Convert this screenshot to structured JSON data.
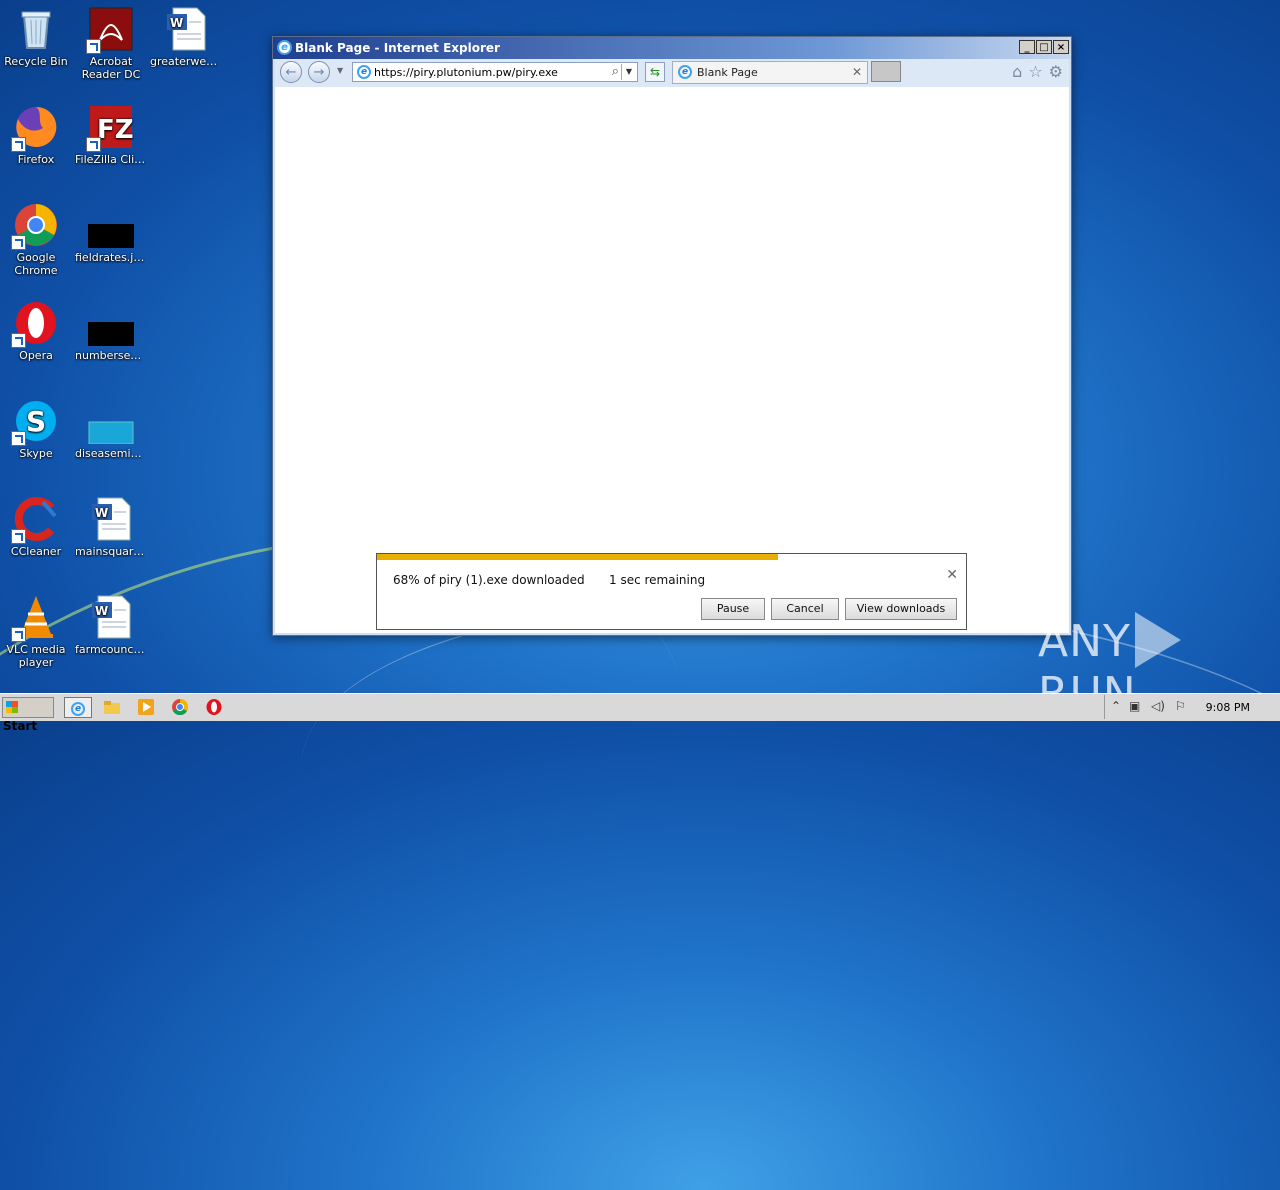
{
  "desktop": {
    "icons": [
      {
        "label": "Recycle Bin",
        "icon": "recycle-bin-icon"
      },
      {
        "label": "Acrobat Reader DC",
        "icon": "acrobat-icon"
      },
      {
        "label": "greaterwee...",
        "icon": "word-doc-icon"
      },
      {
        "label": "Firefox",
        "icon": "firefox-icon"
      },
      {
        "label": "FileZilla Client",
        "icon": "filezilla-icon"
      },
      {
        "label": "Google Chrome",
        "icon": "chrome-icon"
      },
      {
        "label": "fieldrates.jpg",
        "icon": "image-file-icon"
      },
      {
        "label": "Opera",
        "icon": "opera-icon"
      },
      {
        "label": "numbersex...",
        "icon": "image-file-icon"
      },
      {
        "label": "Skype",
        "icon": "skype-icon"
      },
      {
        "label": "diseasemini....",
        "icon": "image-file-icon"
      },
      {
        "label": "CCleaner",
        "icon": "ccleaner-icon"
      },
      {
        "label": "mainsquare.rtf",
        "icon": "word-doc-icon"
      },
      {
        "label": "VLC media player",
        "icon": "vlc-icon"
      },
      {
        "label": "farmcouncil.rtf",
        "icon": "word-doc-icon"
      }
    ]
  },
  "browser": {
    "title": "Blank Page - Internet Explorer",
    "url": "https://piry.plutonium.pw/piry.exe",
    "tab_label": "Blank Page",
    "window_buttons": {
      "minimize": "_",
      "maximize": "□",
      "close": "×"
    }
  },
  "download": {
    "progress_percent": 68,
    "message": "68% of piry (1).exe downloaded",
    "remaining": "1 sec remaining",
    "buttons": {
      "pause": "Pause",
      "cancel": "Cancel",
      "view": "View downloads"
    }
  },
  "taskbar": {
    "start_label": "Start",
    "clock": "9:08 PM"
  },
  "watermark": {
    "left": "ANY",
    "right": "RUN"
  },
  "colors": {
    "progress": "#e8ae00",
    "title_bar": "#1f3f8f",
    "desktop": "#1f73c9"
  }
}
